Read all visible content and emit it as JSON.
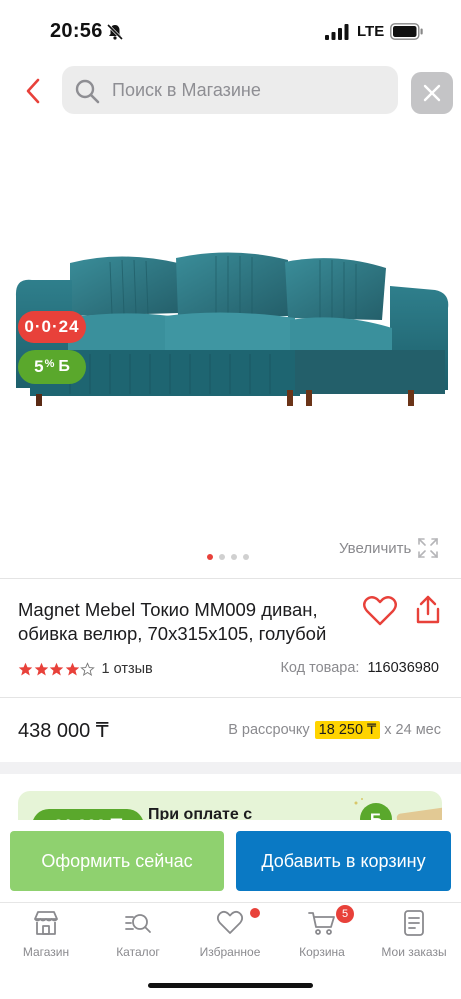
{
  "status_bar": {
    "time": "20:56",
    "network": "LTE",
    "icons": [
      "bell-slash-icon",
      "signal-icon",
      "battery-icon"
    ]
  },
  "search": {
    "placeholder": "Поиск в Магазине",
    "back_icon": "chevron-left-icon",
    "clear_icon": "close-icon"
  },
  "gallery": {
    "timer_badge": "0·0·24",
    "cashback_badge": {
      "percent": "5",
      "percent_sign": "%",
      "currency": "Б"
    },
    "dots": [
      {
        "active": true
      },
      {
        "active": false
      },
      {
        "active": false
      },
      {
        "active": false
      }
    ],
    "zoom_label": "Увеличить"
  },
  "product": {
    "title": "Magnet Mebel Токио MM009 диван, обивка велюр, 70x315x105, голубой",
    "rating": 4,
    "rating_max": 5,
    "reviews": "1 отзыв",
    "sku_label": "Код товара:",
    "sku_value": "116036980"
  },
  "pricing": {
    "price": "438 000 ₸",
    "installment_label": "В рассрочку",
    "installment_amount": "18 250 ₸",
    "installment_term": "x 24 мес"
  },
  "promo": {
    "amount": "21 900 ₸",
    "text": "При оплате с"
  },
  "actions": {
    "checkout_label": "Оформить сейчас",
    "add_to_cart_label": "Добавить в корзину"
  },
  "tabs": [
    {
      "label": "Магазин",
      "icon": "shop-icon"
    },
    {
      "label": "Каталог",
      "icon": "catalog-search-icon"
    },
    {
      "label": "Избранное",
      "icon": "heart-icon"
    },
    {
      "label": "Корзина",
      "icon": "cart-icon"
    },
    {
      "label": "Мои заказы",
      "icon": "orders-icon"
    }
  ],
  "cart_count": "5",
  "colors": {
    "accent_red": "#e8413a",
    "cashback_green": "#5aa82c",
    "checkout_green": "#8fd16f",
    "cart_blue": "#0a79c4",
    "installment_yellow": "#ffd400"
  }
}
